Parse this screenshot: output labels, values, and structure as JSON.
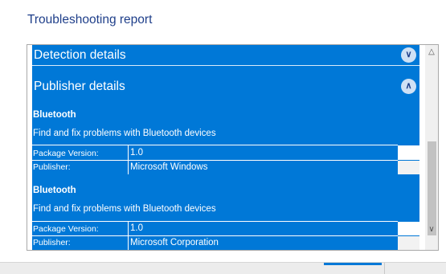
{
  "title": "Troubleshooting report",
  "sections": [
    {
      "label": "Detection details",
      "state": "collapsed",
      "icon": "chevron-down-icon"
    },
    {
      "label": "Publisher details",
      "state": "expanded",
      "icon": "chevron-up-icon"
    }
  ],
  "entries": [
    {
      "name": "Bluetooth",
      "description": "Find and fix problems with Bluetooth devices",
      "package_label": "Package Version:",
      "package_value": "1.0",
      "publisher_label": "Publisher:",
      "publisher_value": "Microsoft Windows"
    },
    {
      "name": "Bluetooth",
      "description": "Find and fix problems with Bluetooth devices",
      "package_label": "Package Version:",
      "package_value": "1.0",
      "publisher_label": "Publisher:",
      "publisher_value": "Microsoft Corporation"
    }
  ],
  "colors": {
    "accent": "#0078d7",
    "title": "#1f3f8a"
  }
}
